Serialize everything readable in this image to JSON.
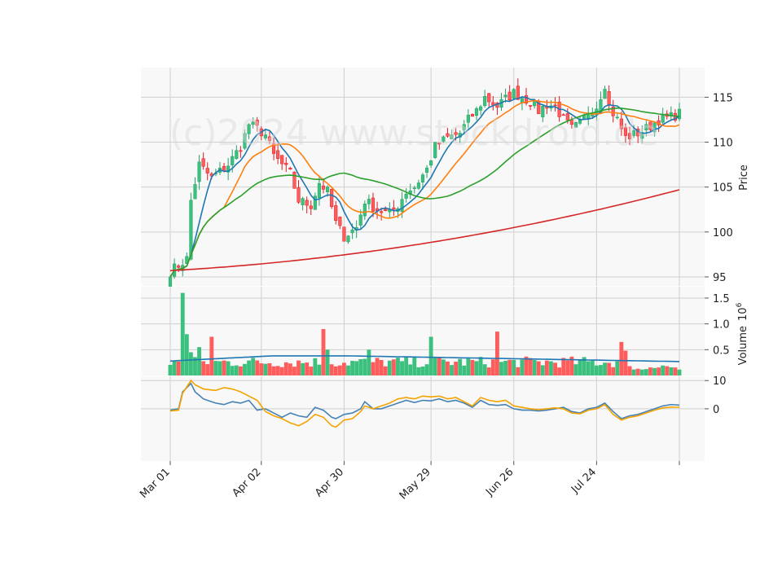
{
  "watermark": "(c)2024 www.stockdroid.de",
  "colors": {
    "up": "#26a269",
    "up_fill": "#3cc07e",
    "down": "#e01b24",
    "down_fill": "#ff5c5c",
    "ma_fast": "#1f77b4",
    "ma_mid": "#ff7f0e",
    "ma_slow": "#2ca02c",
    "ma_long": "#d62728",
    "vol_ma": "#1f77b4",
    "osc_a": "#4682b4",
    "osc_b": "#f5a300",
    "panel_bg": "#f8f8f8",
    "grid": "#d0d0d0"
  },
  "chart_data": [
    {
      "type": "candlestick",
      "panel": "price",
      "ylabel": "Price",
      "ylim": [
        94,
        118.3
      ],
      "yticks": [
        95,
        100,
        105,
        110,
        115
      ],
      "x_tick_labels": [
        "Mar 01",
        "Apr 02",
        "Apr 30",
        "May 29",
        "Jun 26",
        "Jul 24",
        ""
      ],
      "x_tick_index": [
        0,
        22,
        42,
        63,
        83,
        103,
        123
      ],
      "x_count": 124,
      "close_anchors": [
        [
          0,
          95.6
        ],
        [
          4,
          97.0
        ],
        [
          5,
          103.5
        ],
        [
          7,
          107.5
        ],
        [
          10,
          106.0
        ],
        [
          14,
          107.5
        ],
        [
          17,
          109.5
        ],
        [
          19,
          112.0
        ],
        [
          21,
          111.5
        ],
        [
          23,
          110.8
        ],
        [
          25,
          108.5
        ],
        [
          29,
          106.5
        ],
        [
          31,
          103.5
        ],
        [
          34,
          103.0
        ],
        [
          36,
          105.5
        ],
        [
          38,
          104.5
        ],
        [
          40,
          101.0
        ],
        [
          42,
          99.5
        ],
        [
          45,
          100.5
        ],
        [
          47,
          103.5
        ],
        [
          50,
          102.5
        ],
        [
          53,
          102.0
        ],
        [
          55,
          103.0
        ],
        [
          57,
          104.5
        ],
        [
          59,
          105.0
        ],
        [
          62,
          107.0
        ],
        [
          64,
          109.5
        ],
        [
          67,
          110.5
        ],
        [
          70,
          111.0
        ],
        [
          72,
          112.5
        ],
        [
          74,
          113.5
        ],
        [
          76,
          115.0
        ],
        [
          79,
          114.0
        ],
        [
          81,
          114.8
        ],
        [
          83,
          115.5
        ],
        [
          85,
          115.0
        ],
        [
          87,
          114.5
        ],
        [
          89,
          113.5
        ],
        [
          91,
          114.2
        ],
        [
          93,
          114.0
        ],
        [
          95,
          112.5
        ],
        [
          97,
          111.5
        ],
        [
          99,
          112.0
        ],
        [
          101,
          113.5
        ],
        [
          103,
          114.0
        ],
        [
          105,
          116.5
        ],
        [
          106,
          114.0
        ],
        [
          108,
          112.5
        ],
        [
          110,
          110.5
        ],
        [
          113,
          111.0
        ],
        [
          115,
          111.5
        ],
        [
          118,
          112.5
        ],
        [
          121,
          112.8
        ],
        [
          123,
          113.2
        ]
      ],
      "moving_averages": [
        {
          "key": "ma_fast",
          "start": [
            0,
            96.5
          ]
        },
        {
          "key": "ma_mid",
          "start": [
            0,
            96.8
          ]
        },
        {
          "key": "ma_slow",
          "start": [
            0,
            96.9
          ]
        },
        {
          "key": "ma_long",
          "start": [
            0,
            95.7
          ],
          "end": [
            123,
            104.7
          ]
        }
      ]
    },
    {
      "type": "bar",
      "panel": "volume",
      "ylabel": "Volume",
      "ylabel_exponent": "10^6",
      "ylim": [
        0,
        1.72
      ],
      "yticks": [
        0.5,
        1.0,
        1.5
      ],
      "ytick_labels": [
        "0.5",
        "1.0",
        "1.5"
      ],
      "spike_values": [
        [
          3,
          1.6
        ],
        [
          4,
          0.8
        ],
        [
          5,
          0.45
        ],
        [
          7,
          0.55
        ],
        [
          10,
          0.75
        ],
        [
          37,
          0.9
        ],
        [
          38,
          0.5
        ],
        [
          48,
          0.5
        ],
        [
          63,
          0.75
        ],
        [
          79,
          0.85
        ],
        [
          109,
          0.65
        ],
        [
          110,
          0.48
        ]
      ],
      "moving_average": {
        "key": "vol_ma",
        "start": 0.28,
        "peak": 0.38,
        "end": 0.27
      }
    },
    {
      "type": "line",
      "panel": "oscillator",
      "ylim": [
        -18.5,
        11.5
      ],
      "yticks": [
        0,
        10
      ],
      "ytick_labels": [
        "0",
        "10"
      ],
      "series": [
        {
          "key": "osc_a",
          "values": [
            [
              0,
              -0.5
            ],
            [
              2,
              0
            ],
            [
              3,
              6
            ],
            [
              5,
              9
            ],
            [
              6,
              6
            ],
            [
              8,
              3.5
            ],
            [
              11,
              2
            ],
            [
              13,
              1.5
            ],
            [
              15,
              2.5
            ],
            [
              17,
              2
            ],
            [
              19,
              3
            ],
            [
              21,
              -0.5
            ],
            [
              23,
              0
            ],
            [
              25,
              -1.5
            ],
            [
              27,
              -3
            ],
            [
              29,
              -1.5
            ],
            [
              31,
              -2.5
            ],
            [
              33,
              -3
            ],
            [
              35,
              0.5
            ],
            [
              37,
              -0.5
            ],
            [
              39,
              -3
            ],
            [
              40,
              -3.5
            ],
            [
              42,
              -2
            ],
            [
              44,
              -1.5
            ],
            [
              46,
              0
            ],
            [
              47,
              2.5
            ],
            [
              49,
              0
            ],
            [
              51,
              0
            ],
            [
              53,
              1
            ],
            [
              55,
              2
            ],
            [
              57,
              3
            ],
            [
              59,
              2.2
            ],
            [
              61,
              3
            ],
            [
              63,
              2.8
            ],
            [
              65,
              3.5
            ],
            [
              67,
              2.5
            ],
            [
              69,
              3
            ],
            [
              71,
              2
            ],
            [
              73,
              0.5
            ],
            [
              75,
              3
            ],
            [
              77,
              1.5
            ],
            [
              79,
              1.2
            ],
            [
              81,
              1.5
            ],
            [
              83,
              0
            ],
            [
              85,
              -0.5
            ],
            [
              87,
              -0.5
            ],
            [
              89,
              -0.8
            ],
            [
              91,
              -0.5
            ],
            [
              93,
              0
            ],
            [
              95,
              0.5
            ],
            [
              97,
              -1
            ],
            [
              99,
              -1.5
            ],
            [
              101,
              0
            ],
            [
              103,
              0.5
            ],
            [
              105,
              2
            ],
            [
              107,
              -1
            ],
            [
              109,
              -3.5
            ],
            [
              111,
              -2.5
            ],
            [
              113,
              -2
            ],
            [
              115,
              -1
            ],
            [
              117,
              0
            ],
            [
              119,
              1
            ],
            [
              121,
              1.5
            ],
            [
              123,
              1.3
            ]
          ]
        },
        {
          "key": "osc_b",
          "values": [
            [
              0,
              -0.8
            ],
            [
              2,
              -0.5
            ],
            [
              3,
              5.5
            ],
            [
              5,
              10
            ],
            [
              6,
              8.5
            ],
            [
              8,
              7
            ],
            [
              11,
              6.5
            ],
            [
              13,
              7.5
            ],
            [
              15,
              7
            ],
            [
              17,
              6
            ],
            [
              19,
              4.5
            ],
            [
              21,
              3
            ],
            [
              23,
              -1
            ],
            [
              25,
              -2.5
            ],
            [
              27,
              -3.5
            ],
            [
              29,
              -5
            ],
            [
              31,
              -6
            ],
            [
              33,
              -4.5
            ],
            [
              35,
              -2
            ],
            [
              37,
              -3
            ],
            [
              39,
              -6
            ],
            [
              40,
              -6.5
            ],
            [
              42,
              -4
            ],
            [
              44,
              -3.5
            ],
            [
              46,
              -1
            ],
            [
              47,
              1
            ],
            [
              49,
              0
            ],
            [
              51,
              1
            ],
            [
              53,
              2
            ],
            [
              55,
              3.5
            ],
            [
              57,
              4
            ],
            [
              59,
              3.5
            ],
            [
              61,
              4.5
            ],
            [
              63,
              4.2
            ],
            [
              65,
              4.5
            ],
            [
              67,
              3.5
            ],
            [
              69,
              4
            ],
            [
              71,
              2.5
            ],
            [
              73,
              1
            ],
            [
              75,
              4
            ],
            [
              77,
              3
            ],
            [
              79,
              2.5
            ],
            [
              81,
              3
            ],
            [
              83,
              1
            ],
            [
              85,
              0.5
            ],
            [
              87,
              0
            ],
            [
              89,
              -0.3
            ],
            [
              91,
              0
            ],
            [
              93,
              0.3
            ],
            [
              95,
              0
            ],
            [
              97,
              -1.5
            ],
            [
              99,
              -1.8
            ],
            [
              101,
              -0.5
            ],
            [
              103,
              0
            ],
            [
              105,
              1.5
            ],
            [
              107,
              -2
            ],
            [
              109,
              -4
            ],
            [
              111,
              -3
            ],
            [
              113,
              -2.5
            ],
            [
              115,
              -1.5
            ],
            [
              117,
              -0.5
            ],
            [
              119,
              0.3
            ],
            [
              121,
              0.6
            ],
            [
              123,
              0.5
            ]
          ]
        }
      ]
    }
  ]
}
